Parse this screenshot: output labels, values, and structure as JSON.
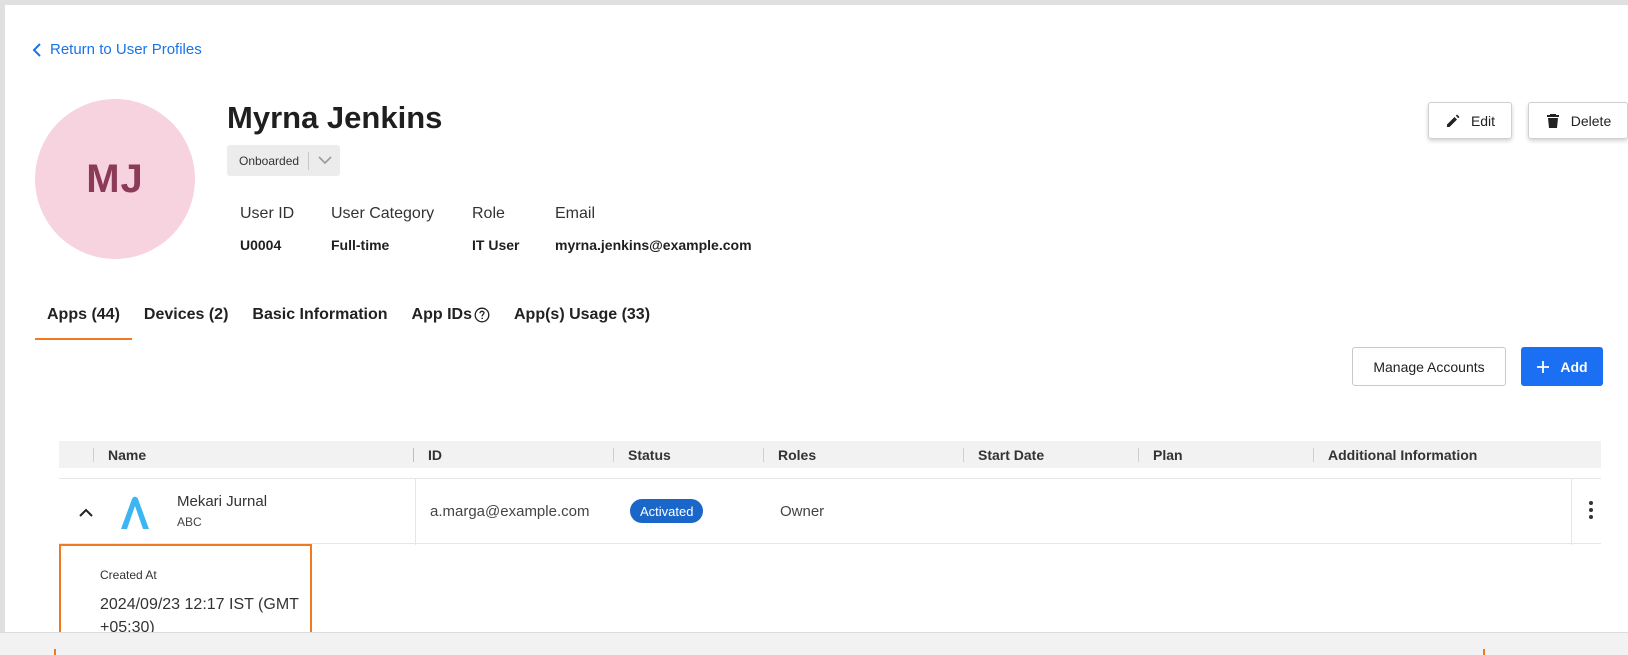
{
  "nav": {
    "back_label": "Return to User Profiles"
  },
  "profile": {
    "initials": "MJ",
    "name": "Myrna Jenkins",
    "status": "Onboarded",
    "fields": [
      {
        "label": "User ID",
        "value": "U0004"
      },
      {
        "label": "User Category",
        "value": "Full-time"
      },
      {
        "label": "Role",
        "value": "IT User"
      },
      {
        "label": "Email",
        "value": "myrna.jenkins@example.com"
      }
    ]
  },
  "actions": {
    "edit_label": "Edit",
    "delete_label": "Delete"
  },
  "tabs": [
    {
      "label": "Apps (44)",
      "active": true
    },
    {
      "label": "Devices (2)"
    },
    {
      "label": "Basic Information"
    },
    {
      "label": "App IDs"
    },
    {
      "label": "App(s) Usage (33)"
    }
  ],
  "toolbar": {
    "manage_label": "Manage Accounts",
    "add_label": "Add"
  },
  "table": {
    "columns": [
      "Name",
      "ID",
      "Status",
      "Roles",
      "Start Date",
      "Plan",
      "Additional Information"
    ],
    "rows": [
      {
        "app_name": "Mekari Jurnal",
        "app_sub": "ABC",
        "id": "a.marga@example.com",
        "status": "Activated",
        "roles": "Owner",
        "start_date": "",
        "plan": "",
        "additional": ""
      }
    ]
  },
  "detail": {
    "label": "Created At",
    "value": "2024/09/23 12:17 IST (GMT +05:30)"
  },
  "colors": {
    "accent_orange": "#f07a22",
    "primary_blue": "#1a6ff2",
    "avatar_bg": "#f6d3de",
    "badge_blue": "#1b66c9"
  }
}
